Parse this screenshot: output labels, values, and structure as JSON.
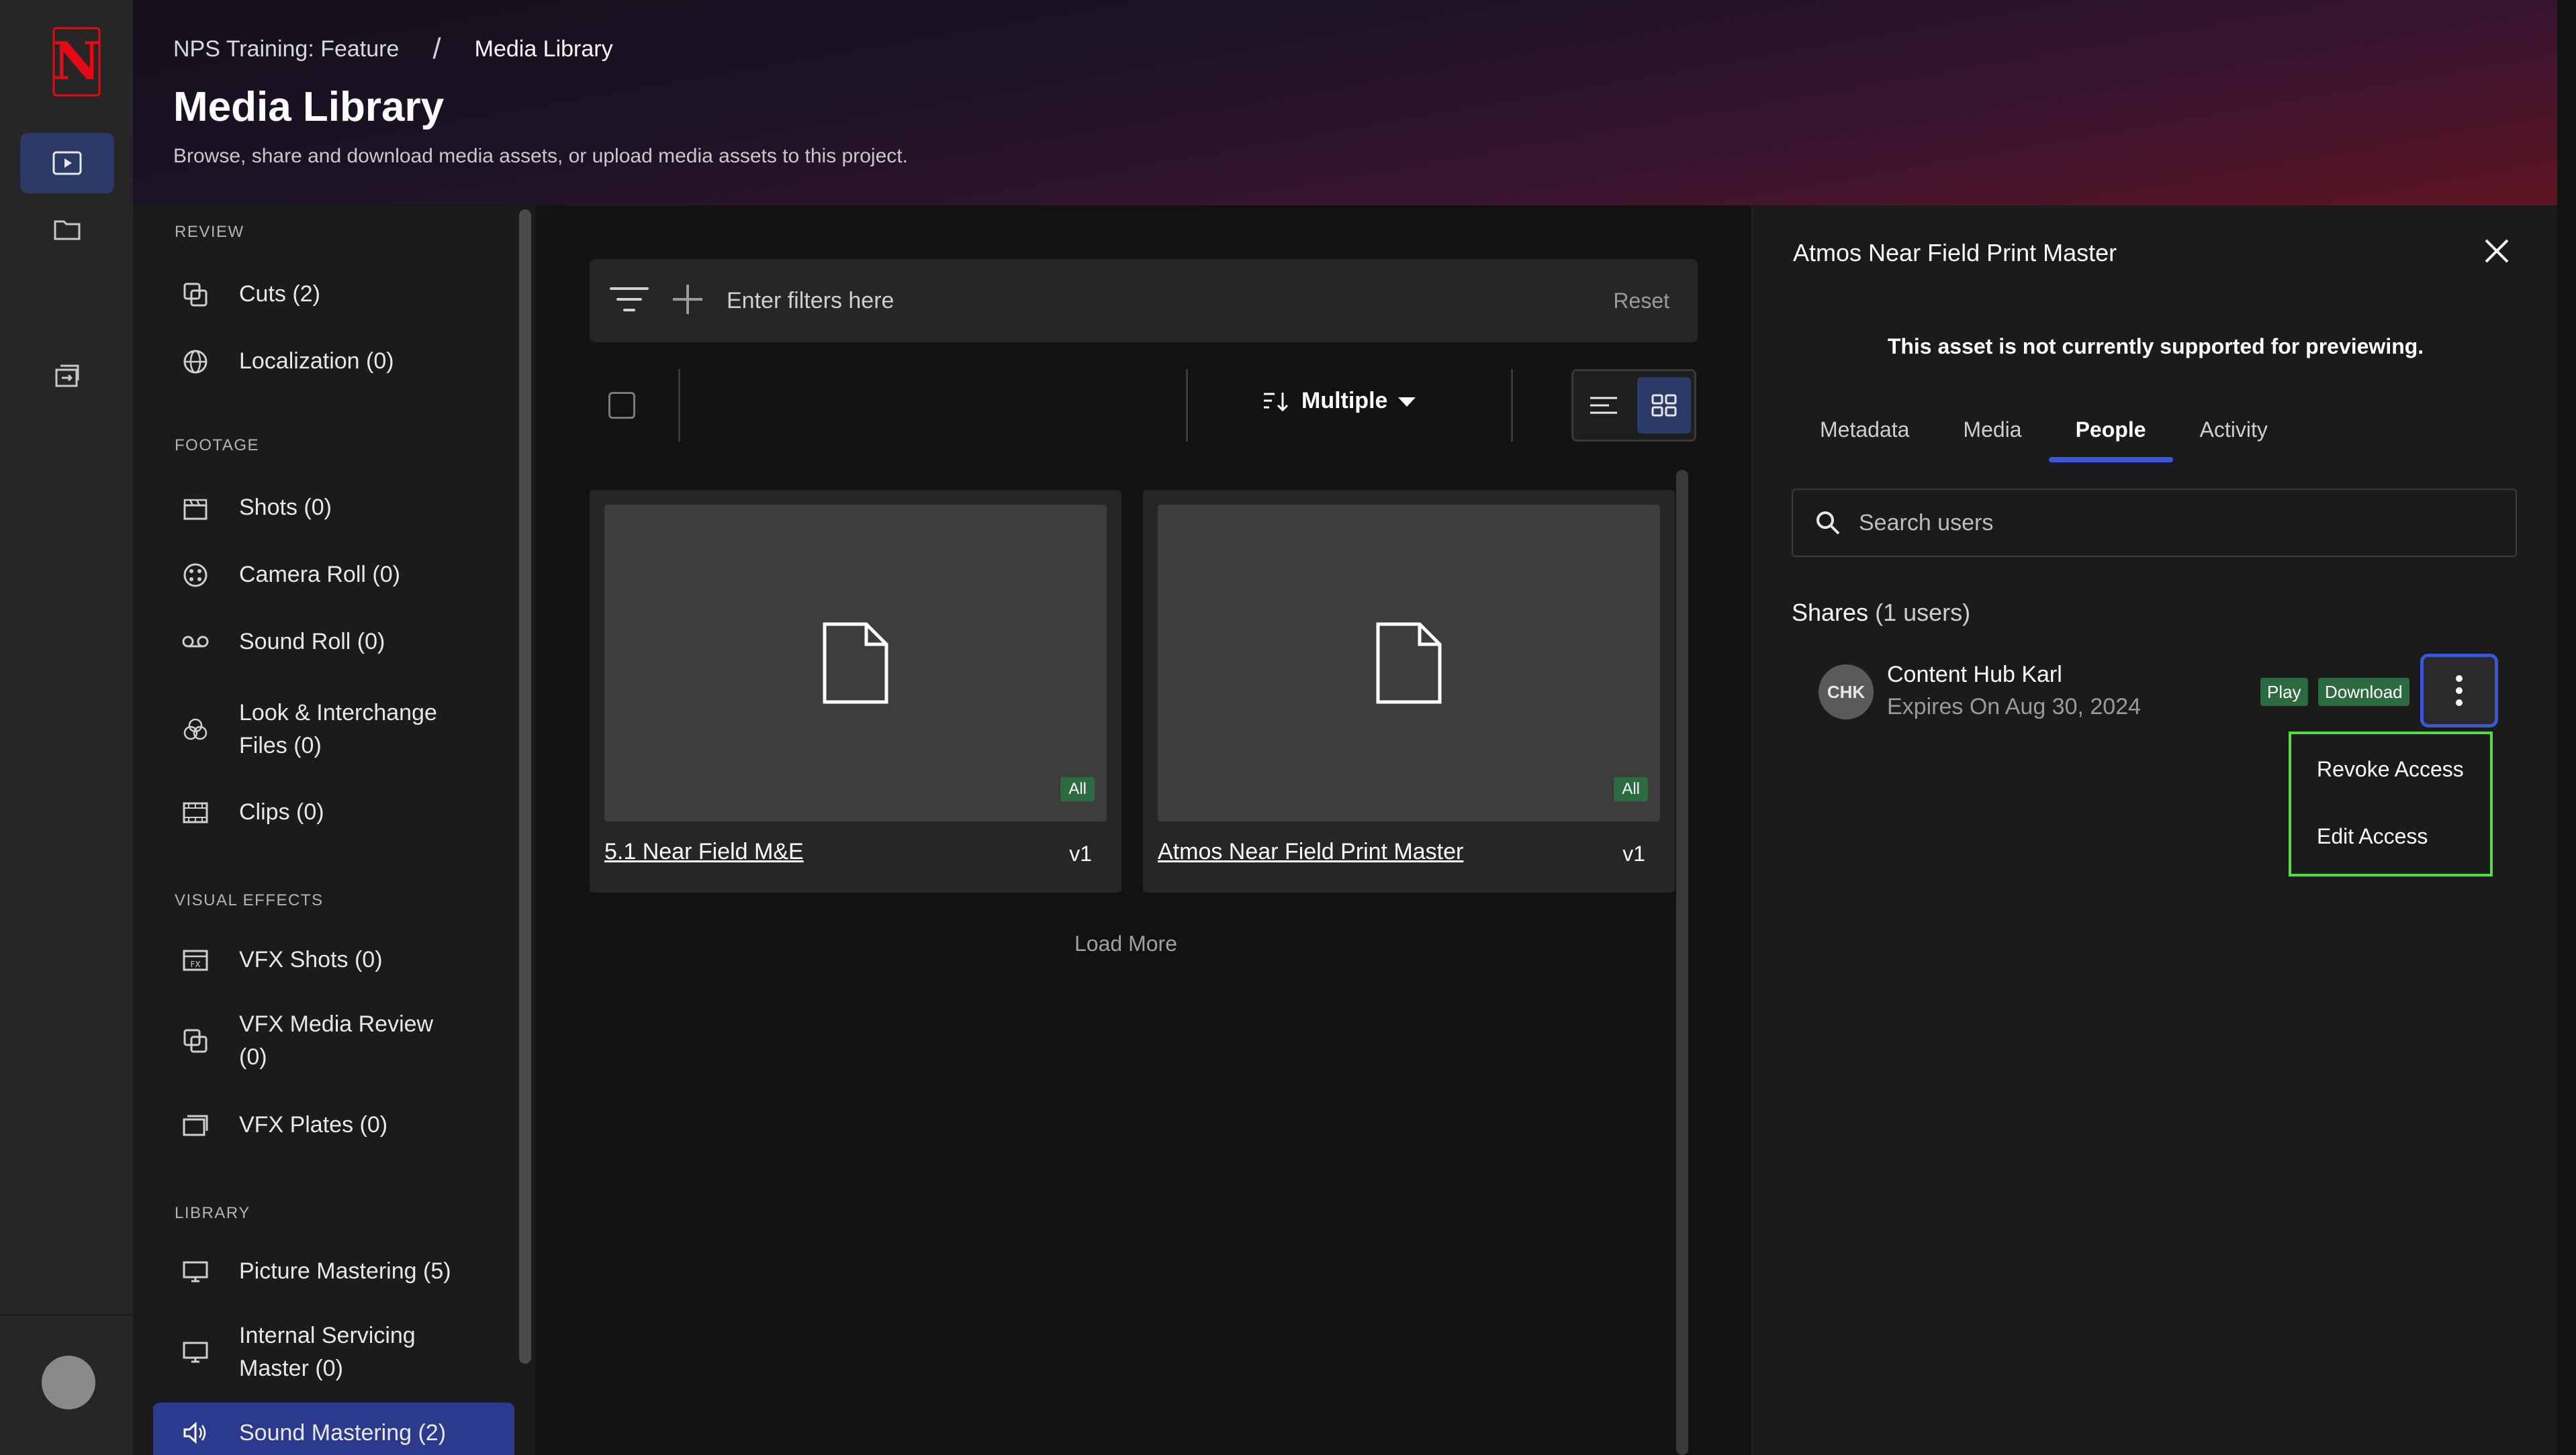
{
  "breadcrumb": {
    "parent": "NPS Training: Feature",
    "separator": "/",
    "current": "Media Library"
  },
  "header": {
    "title": "Media Library",
    "subtitle": "Browse, share and download media assets, or upload media assets to this project."
  },
  "rail": {
    "logo": "N"
  },
  "sidebar": {
    "sections": {
      "review": "REVIEW",
      "footage": "FOOTAGE",
      "visual_effects": "VISUAL EFFECTS",
      "library": "LIBRARY"
    },
    "items": [
      {
        "label": "Cuts (2)",
        "icon": "cuts-icon"
      },
      {
        "label": "Localization (0)",
        "icon": "globe-icon"
      },
      {
        "label": "Shots (0)",
        "icon": "clapper-icon"
      },
      {
        "label": "Camera Roll (0)",
        "icon": "film-reel-icon"
      },
      {
        "label": "Sound Roll (0)",
        "icon": "tape-icon"
      },
      {
        "label": "Look & Interchange Files (0)",
        "icon": "color-circles-icon"
      },
      {
        "label": "Clips (0)",
        "icon": "film-strip-icon"
      },
      {
        "label": "VFX Shots (0)",
        "icon": "vfx-clapper-icon"
      },
      {
        "label": "VFX Media Review (0)",
        "icon": "review-icon"
      },
      {
        "label": "VFX Plates (0)",
        "icon": "plates-icon"
      },
      {
        "label": "Picture Mastering (5)",
        "icon": "monitor-icon"
      },
      {
        "label": "Internal Servicing Master (0)",
        "icon": "monitor-icon"
      },
      {
        "label": "Sound Mastering (2)",
        "icon": "speaker-icon",
        "active": true
      }
    ]
  },
  "filter": {
    "placeholder": "Enter filters here",
    "reset": "Reset"
  },
  "toolbar": {
    "sort_label": "Multiple"
  },
  "assets": [
    {
      "title": "5.1 Near Field M&E",
      "badge": "All",
      "version": "v1"
    },
    {
      "title": "Atmos Near Field Print Master",
      "badge": "All",
      "version": "v1"
    }
  ],
  "load_more": "Load More",
  "panel": {
    "title": "Atmos Near Field Print Master",
    "note": "This asset is not currently supported for previewing.",
    "tabs": [
      "Metadata",
      "Media",
      "People",
      "Activity"
    ],
    "active_tab": "People",
    "search_placeholder": "Search users",
    "shares_label": "Shares",
    "shares_count": "(1 users)",
    "share": {
      "initials": "CHK",
      "name": "Content Hub Karl",
      "expires": "Expires On Aug 30, 2024",
      "tags": [
        "Play",
        "Download"
      ]
    },
    "menu": [
      "Revoke Access",
      "Edit Access"
    ]
  },
  "colors": {
    "accent": "#3a57d9",
    "active_nav": "#2b3a8c",
    "badge_green": "#2c6b3f",
    "menu_highlight": "#4fdc3c"
  }
}
